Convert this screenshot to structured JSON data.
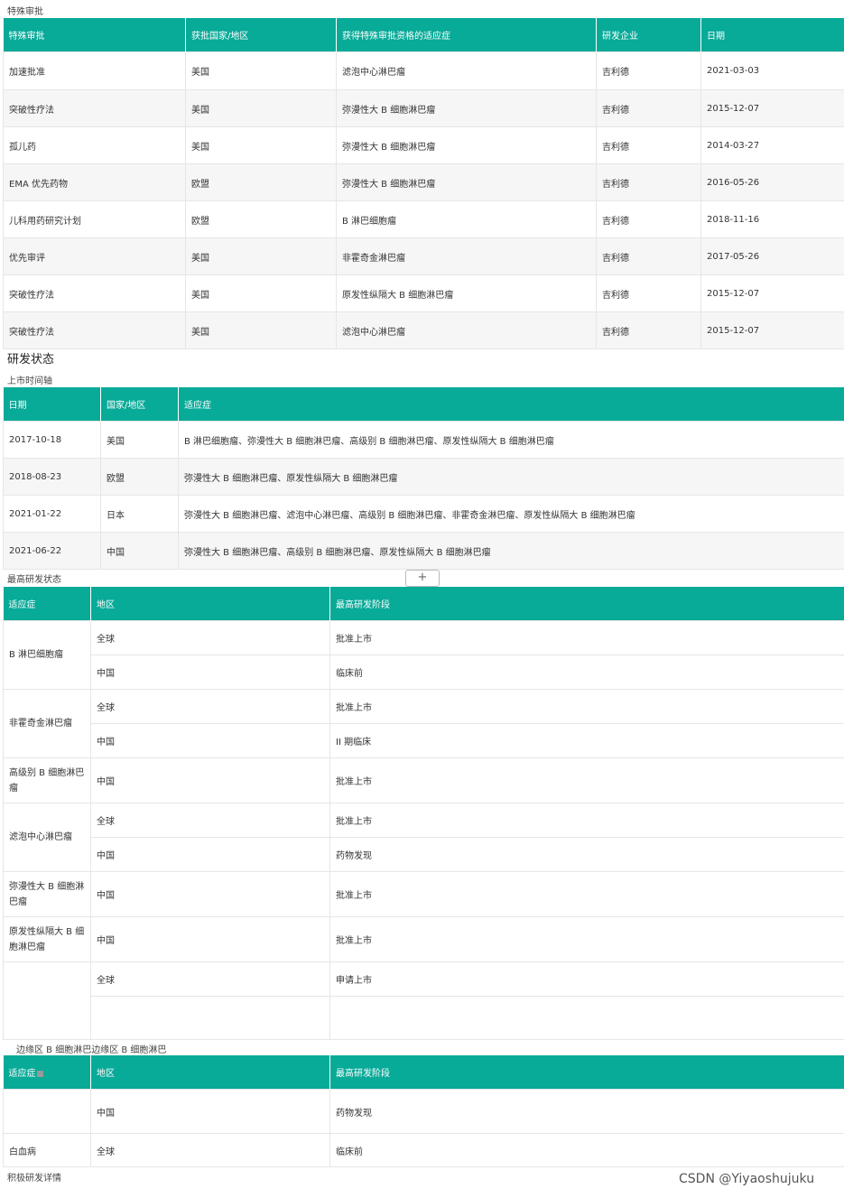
{
  "special": {
    "section_label": "特殊审批",
    "headers": [
      "特殊审批",
      "获批国家/地区",
      "获得特殊审批资格的适应症",
      "研发企业",
      "日期"
    ],
    "rows": [
      [
        "加速批准",
        "美国",
        "滤泡中心淋巴瘤",
        "吉利德",
        "2021-03-03"
      ],
      [
        "突破性疗法",
        "美国",
        "弥漫性大 B 细胞淋巴瘤",
        "吉利德",
        "2015-12-07"
      ],
      [
        "孤儿药",
        "美国",
        "弥漫性大 B 细胞淋巴瘤",
        "吉利德",
        "2014-03-27"
      ],
      [
        "EMA 优先药物",
        "欧盟",
        "弥漫性大 B 细胞淋巴瘤",
        "吉利德",
        "2016-05-26"
      ],
      [
        "儿科用药研究计划",
        "欧盟",
        "B 淋巴细胞瘤",
        "吉利德",
        "2018-11-16"
      ],
      [
        "优先审评",
        "美国",
        "非霍奇金淋巴瘤",
        "吉利德",
        "2017-05-26"
      ],
      [
        "突破性疗法",
        "美国",
        "原发性纵隔大 B 细胞淋巴瘤",
        "吉利德",
        "2015-12-07"
      ],
      [
        "突破性疗法",
        "美国",
        "滤泡中心淋巴瘤",
        "吉利德",
        "2015-12-07"
      ]
    ]
  },
  "status_title": "研发状态",
  "timeline": {
    "label": "上市时间轴",
    "headers": [
      "日期",
      "国家/地区",
      "适应症"
    ],
    "rows": [
      [
        "2017-10-18",
        "美国",
        "B 淋巴细胞瘤、弥漫性大 B 细胞淋巴瘤、高级别 B 细胞淋巴瘤、原发性纵隔大 B 细胞淋巴瘤"
      ],
      [
        "2018-08-23",
        "欧盟",
        "弥漫性大 B 细胞淋巴瘤、原发性纵隔大 B 细胞淋巴瘤"
      ],
      [
        "2021-01-22",
        "日本",
        "弥漫性大 B 细胞淋巴瘤、滤泡中心淋巴瘤、高级别 B 细胞淋巴瘤、非霍奇金淋巴瘤、原发性纵隔大 B 细胞淋巴瘤"
      ],
      [
        "2021-06-22",
        "中国",
        "弥漫性大 B 细胞淋巴瘤、高级别 B 细胞淋巴瘤、原发性纵隔大 B 细胞淋巴瘤"
      ]
    ]
  },
  "highest": {
    "label": "最高研发状态",
    "headers": [
      "适应症",
      "地区",
      "最高研发阶段"
    ],
    "groups": [
      {
        "indication": "B 淋巴细胞瘤",
        "rows": [
          [
            "全球",
            "批准上市"
          ],
          [
            "中国",
            "临床前"
          ]
        ]
      },
      {
        "indication": "非霍奇金淋巴瘤",
        "rows": [
          [
            "全球",
            "批准上市"
          ],
          [
            "中国",
            "II 期临床"
          ]
        ]
      },
      {
        "indication": "高级别 B 细胞淋巴瘤",
        "rows": [
          [
            "中国",
            "批准上市"
          ]
        ]
      },
      {
        "indication": "滤泡中心淋巴瘤",
        "rows": [
          [
            "全球",
            "批准上市"
          ],
          [
            "中国",
            "药物发现"
          ]
        ]
      },
      {
        "indication": "弥漫性大 B 细胞淋巴瘤",
        "rows": [
          [
            "中国",
            "批准上市"
          ]
        ]
      },
      {
        "indication": "原发性纵隔大 B 细胞淋巴瘤",
        "rows": [
          [
            "中国",
            "批准上市"
          ]
        ]
      },
      {
        "indication": "",
        "rows": [
          [
            "全球",
            "申请上市"
          ],
          [
            "",
            ""
          ]
        ]
      }
    ]
  },
  "orphan_text": "边缘区 B 细胞淋巴边缘区 B 细胞淋巴",
  "highest2": {
    "headers": [
      "适应症",
      "地区",
      "最高研发阶段"
    ],
    "rows": [
      [
        "",
        "中国",
        "药物发现"
      ],
      [
        "白血病",
        "全球",
        "临床前"
      ]
    ]
  },
  "footer_label": "积极研发详情",
  "plus_label": "+",
  "watermark": "CSDN @Yiyaoshujuku"
}
